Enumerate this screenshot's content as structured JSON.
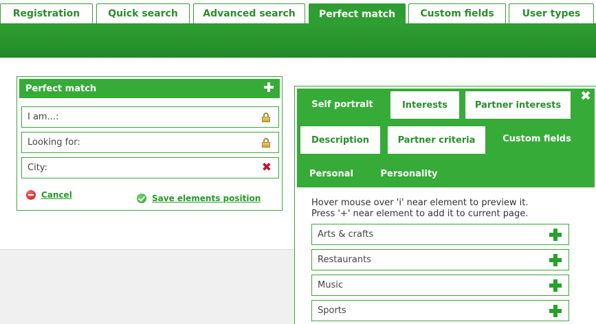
{
  "top_tabs": [
    {
      "label": "Registration"
    },
    {
      "label": "Quick search"
    },
    {
      "label": "Advanced search"
    },
    {
      "label": "Perfect match",
      "active": true
    },
    {
      "label": "Custom fields"
    },
    {
      "label": "User types"
    }
  ],
  "perfect_match_panel": {
    "title": "Perfect match",
    "fields": [
      {
        "label": "I am...:",
        "icon": "lock-icon"
      },
      {
        "label": "Looking for:",
        "icon": "lock-icon"
      },
      {
        "label": "City:",
        "icon": "remove-icon"
      }
    ],
    "cancel_label": "Cancel",
    "save_label": "Save elements position"
  },
  "elements_panel": {
    "close_glyph": "✖",
    "tabs": [
      {
        "label": "Self portrait"
      },
      {
        "label": "Interests"
      },
      {
        "label": "Partner interests"
      },
      {
        "label": "Description"
      },
      {
        "label": "Partner criteria"
      },
      {
        "label": "Custom fields",
        "active": true
      },
      {
        "label": "Personal"
      },
      {
        "label": "Personality"
      }
    ],
    "hint_line1": "Hover mouse over 'i' near element to preview it.",
    "hint_line2": "Press '+' near element to add it to current page.",
    "items": [
      {
        "label": "Arts & crafts"
      },
      {
        "label": "Restaurants"
      },
      {
        "label": "Music"
      },
      {
        "label": "Sports"
      }
    ]
  },
  "colors": {
    "brand_green": "#2e9e32",
    "remove_red": "#c0152f"
  }
}
